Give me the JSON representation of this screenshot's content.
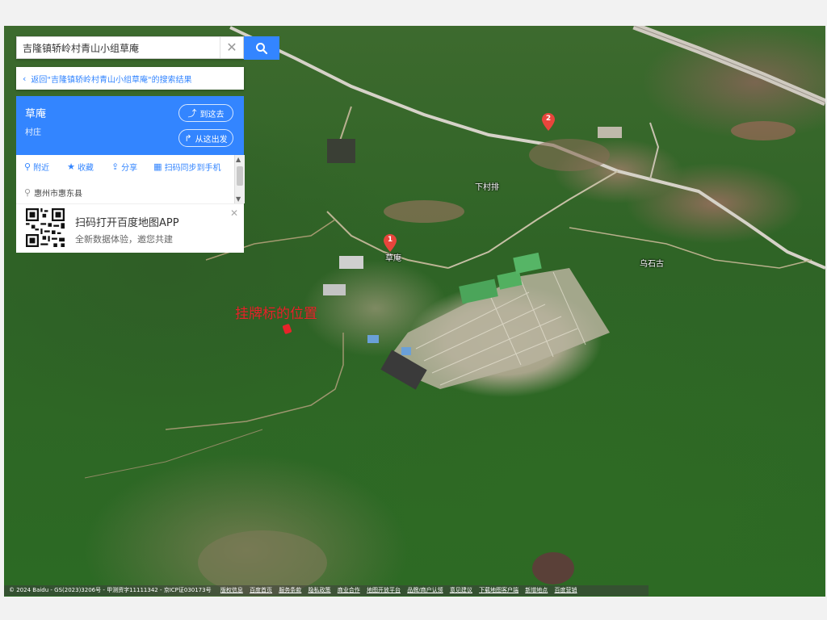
{
  "search": {
    "query": "吉隆镇轿岭村青山小组草庵",
    "clear_icon": "close-icon",
    "search_icon": "search-icon"
  },
  "back_link": {
    "text": "返回\"吉隆镇轿岭村青山小组草庵\"的搜索结果"
  },
  "result": {
    "name": "草庵",
    "category": "村庄",
    "go_here": "到这去",
    "from_here": "从这出发",
    "actions": [
      {
        "label": "附近",
        "icon": "pin-icon"
      },
      {
        "label": "收藏",
        "icon": "star-icon"
      },
      {
        "label": "分享",
        "icon": "share-icon"
      },
      {
        "label": "扫码同步到手机",
        "icon": "qr-icon"
      }
    ],
    "address": "惠州市惠东县"
  },
  "promo": {
    "title": "扫码打开百度地图APP",
    "subtitle": "全新数据体验，邀您共建"
  },
  "map": {
    "markers": [
      {
        "num": "1",
        "label": "草庵"
      },
      {
        "num": "2"
      }
    ],
    "place_labels": {
      "xiacunpai": "下村排",
      "wushigu": "乌石古"
    },
    "annotation": "挂牌标的位置",
    "marker_color": "#e8453c",
    "annotation_color": "#e8232a"
  },
  "footer": {
    "copyright": "© 2024 Baidu - GS(2023)3206号 - 甲测资字11111342 - 京ICP证030173号",
    "links": [
      "版权信息",
      "百度首页",
      "服务条款",
      "隐私政策",
      "商业合作",
      "地图开放平台",
      "品牌/商户认领",
      "意见建议",
      "下载地图客户端",
      "新增地点",
      "百度营销"
    ]
  }
}
